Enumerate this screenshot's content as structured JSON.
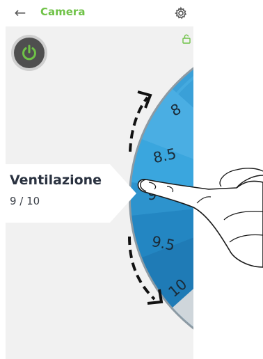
{
  "header": {
    "back_icon": "arrow-left-icon",
    "title": "Camera",
    "settings_icon": "gear-icon"
  },
  "controls": {
    "power_icon": "power-icon",
    "lock_icon": "unlocked-padlock-icon"
  },
  "dial": {
    "labels": [
      "8",
      "8.5",
      "9",
      "9.5",
      "10"
    ],
    "selected": "9"
  },
  "parameter": {
    "name": "Ventilazione",
    "value": "9 / 10"
  },
  "colors": {
    "accent_green": "#6fc247",
    "dial_blue": "#3aa0d8",
    "dial_rim": "#8d9aa3"
  }
}
